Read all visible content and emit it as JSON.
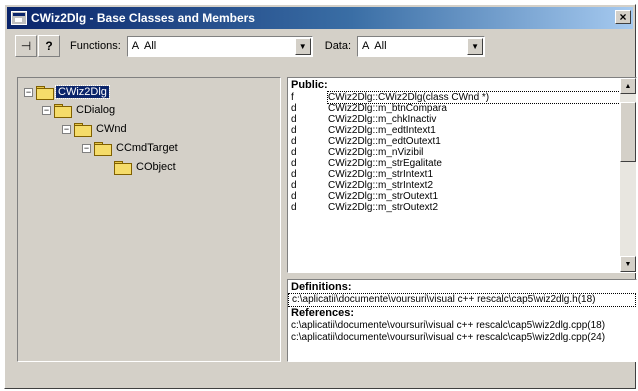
{
  "window": {
    "title": "CWiz2Dlg - Base Classes and Members",
    "close_glyph": "×"
  },
  "toolbar": {
    "pin_glyph": "⊣",
    "help_glyph": "?",
    "functions_label": "Functions:",
    "functions_value": "A  All",
    "data_label": "Data:",
    "data_value": "A  All",
    "dropdown_glyph": "▼"
  },
  "tree": {
    "nodes": [
      {
        "label": "CWiz2Dlg",
        "expander": "−"
      },
      {
        "label": "CDialog",
        "expander": "−"
      },
      {
        "label": "CWnd",
        "expander": "−"
      },
      {
        "label": "CCmdTarget",
        "expander": "−"
      },
      {
        "label": "CObject",
        "expander": ""
      }
    ]
  },
  "members": {
    "header": "Public:",
    "rows": [
      {
        "kind": "f",
        "name": "CWiz2Dlg::CWiz2Dlg(class CWnd *)"
      },
      {
        "kind": "d",
        "name": "CWiz2Dlg::m_btnCompara"
      },
      {
        "kind": "d",
        "name": "CWiz2Dlg::m_chkInactiv"
      },
      {
        "kind": "d",
        "name": "CWiz2Dlg::m_edtIntext1"
      },
      {
        "kind": "d",
        "name": "CWiz2Dlg::m_edtOutext1"
      },
      {
        "kind": "d",
        "name": "CWiz2Dlg::m_nVizibil"
      },
      {
        "kind": "d",
        "name": "CWiz2Dlg::m_strEgalitate"
      },
      {
        "kind": "d",
        "name": "CWiz2Dlg::m_strIntext1"
      },
      {
        "kind": "d",
        "name": "CWiz2Dlg::m_strIntext2"
      },
      {
        "kind": "d",
        "name": "CWiz2Dlg::m_strOutext1"
      },
      {
        "kind": "d",
        "name": "CWiz2Dlg::m_strOutext2"
      }
    ],
    "scroll_up": "▲",
    "scroll_down": "▼"
  },
  "definitions": {
    "header": "Definitions:",
    "items": [
      "c:\\aplicatii\\documente\\voursuri\\visual c++ rescalc\\cap5\\wiz2dlg.h(18)"
    ]
  },
  "references": {
    "header": "References:",
    "items": [
      "c:\\aplicatii\\documente\\voursuri\\visual c++ rescalc\\cap5\\wiz2dlg.cpp(18)",
      "c:\\aplicatii\\documente\\voursuri\\visual c++ rescalc\\cap5\\wiz2dlg.cpp(24)"
    ]
  }
}
